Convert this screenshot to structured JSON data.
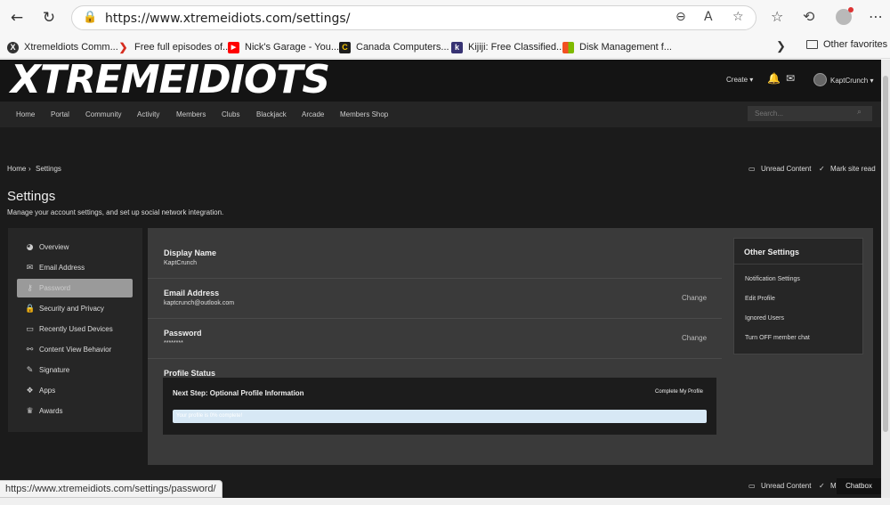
{
  "browser": {
    "url": "https://www.xtremeidiots.com/settings/",
    "status_url": "https://www.xtremeidiots.com/settings/password/",
    "favorites": [
      {
        "label": "Xtremeldiots Comm...",
        "icon": "xi-icon",
        "color": "#333333"
      },
      {
        "label": "Free full episodes of...",
        "icon": "arrow-icon",
        "color": "#d62d20"
      },
      {
        "label": "Nick's Garage - You...",
        "icon": "youtube-icon",
        "color": "#ff0000"
      },
      {
        "label": "Canada Computers...",
        "icon": "cc-icon",
        "color": "#1d1d1d"
      },
      {
        "label": "Kijiji: Free Classified...",
        "icon": "kijiji-icon",
        "color": "#373373"
      },
      {
        "label": "Disk Management f...",
        "icon": "windows-icon",
        "color": "#f25022"
      }
    ],
    "other_favorites": "Other favorites"
  },
  "site": {
    "logo": "XTREMEIDIOTS",
    "create": "Create ▾",
    "username": "KaptCrunch ▾",
    "nav": [
      "Home",
      "Portal",
      "Community",
      "Activity",
      "Members",
      "Clubs",
      "Blackjack",
      "Arcade",
      "Members Shop"
    ],
    "search_placeholder": "Search..."
  },
  "breadcrumb": {
    "home": "Home",
    "sep": "›",
    "current": "Settings"
  },
  "top_links": {
    "unread": "Unread Content",
    "mark_read": "Mark site read"
  },
  "page": {
    "title": "Settings",
    "description": "Manage your account settings, and set up social network integration."
  },
  "sidebar": [
    {
      "label": "Overview",
      "icon": "dashboard-icon"
    },
    {
      "label": "Email Address",
      "icon": "envelope-icon"
    },
    {
      "label": "Password",
      "icon": "key-icon",
      "active": true
    },
    {
      "label": "Security and Privacy",
      "icon": "lock-icon"
    },
    {
      "label": "Recently Used Devices",
      "icon": "laptop-icon"
    },
    {
      "label": "Content View Behavior",
      "icon": "link-icon"
    },
    {
      "label": "Signature",
      "icon": "pen-icon"
    },
    {
      "label": "Apps",
      "icon": "cubes-icon"
    },
    {
      "label": "Awards",
      "icon": "trophy-icon"
    }
  ],
  "fields": {
    "display_name": {
      "label": "Display Name",
      "value": "KaptCrunch"
    },
    "email": {
      "label": "Email Address",
      "value": "kaptcrunch@outlook.com",
      "action": "Change"
    },
    "password": {
      "label": "Password",
      "value": "********",
      "action": "Change"
    }
  },
  "profile_status": {
    "heading": "Profile Status",
    "next_step": "Next Step: Optional Profile Information",
    "complete_link": "Complete My Profile",
    "progress_text": "Your profile is 0% complete!",
    "progress": 0
  },
  "other_settings": {
    "title": "Other Settings",
    "links": [
      "Notification Settings",
      "Edit Profile",
      "Ignored Users",
      "Turn OFF member chat"
    ]
  },
  "footer": {
    "unread": "Unread Content",
    "mark_read": "Ma",
    "chatbox": "Chatbox"
  }
}
